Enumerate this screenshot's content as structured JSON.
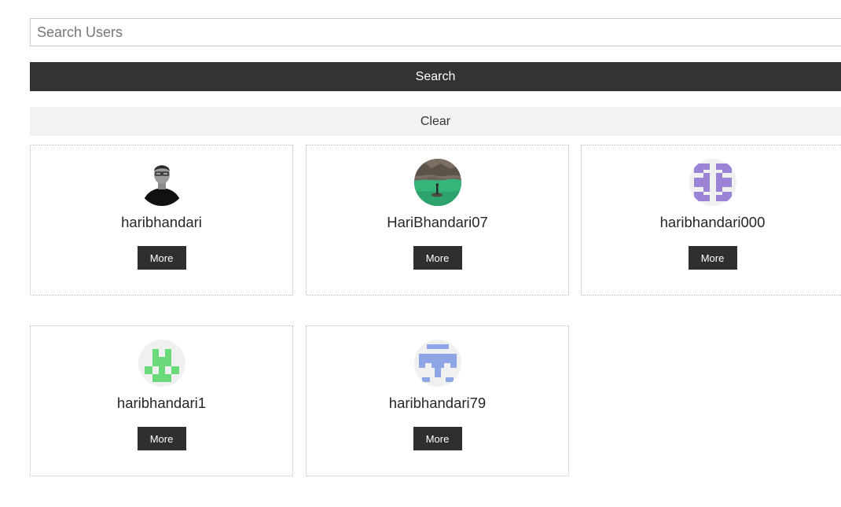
{
  "search": {
    "placeholder": "Search Users",
    "button_label": "Search",
    "clear_label": "Clear"
  },
  "users": [
    {
      "username": "haribhandari",
      "more_label": "More",
      "avatar": "photo-portrait"
    },
    {
      "username": "HariBhandari07",
      "more_label": "More",
      "avatar": "photo-landscape"
    },
    {
      "username": "haribhandari000",
      "more_label": "More",
      "avatar": "identicon-purple"
    },
    {
      "username": "haribhandari1",
      "more_label": "More",
      "avatar": "identicon-green"
    },
    {
      "username": "haribhandari79",
      "more_label": "More",
      "avatar": "identicon-blue"
    }
  ],
  "colors": {
    "primary_button": "#333333",
    "secondary_button": "#f2f2f2",
    "identicon_purple": "#9b84d6",
    "identicon_green": "#6ad97a",
    "identicon_blue": "#8fa6e6",
    "identicon_bg": "#f0f0f0"
  }
}
